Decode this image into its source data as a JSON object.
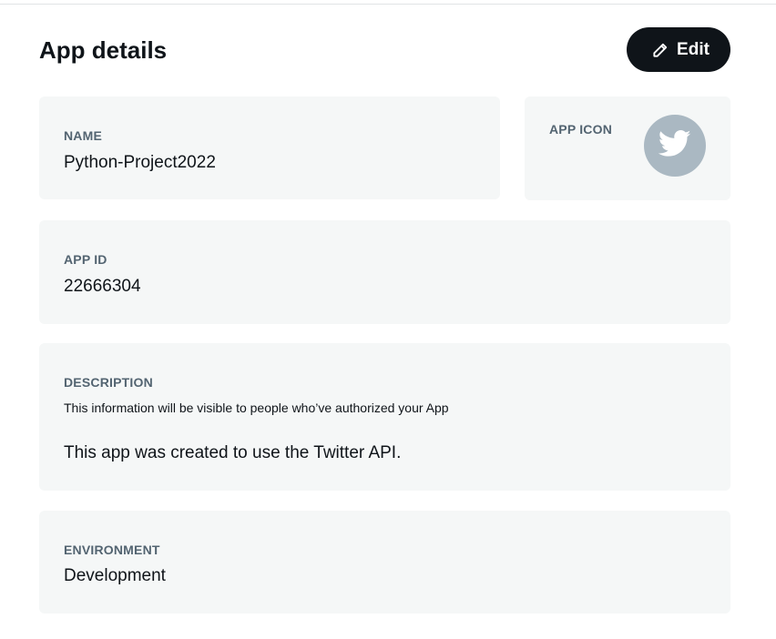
{
  "page": {
    "title": "App details"
  },
  "toolbar": {
    "edit_label": "Edit",
    "edit_icon": "pencil-icon"
  },
  "fields": {
    "name": {
      "label": "NAME",
      "value": "Python-Project2022"
    },
    "app_icon": {
      "label": "APP ICON",
      "icon": "twitter-bird-icon"
    },
    "app_id": {
      "label": "APP ID",
      "value": "22666304"
    },
    "description": {
      "label": "DESCRIPTION",
      "helper": "This information will be visible to people who’ve authorized your App",
      "value": "This app was created to use the Twitter API."
    },
    "environment": {
      "label": "ENVIRONMENT",
      "value": "Development"
    }
  },
  "colors": {
    "card_bg": "#f5f7f7",
    "button_bg": "#0f1419",
    "label": "#536471",
    "avatar_bg": "#aab8c2"
  }
}
